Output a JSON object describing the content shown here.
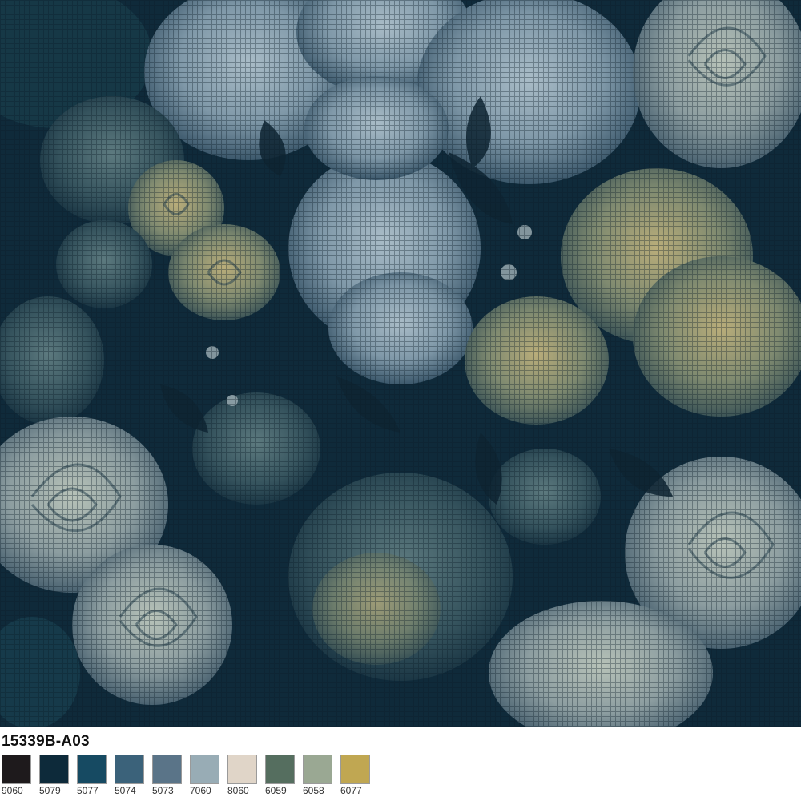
{
  "pattern": {
    "code": "15339B-A03",
    "palette": [
      {
        "number": "9060",
        "color": "#1e1a1c"
      },
      {
        "number": "5079",
        "color": "#0d2a3a"
      },
      {
        "number": "5077",
        "color": "#164a62"
      },
      {
        "number": "5074",
        "color": "#3b627a"
      },
      {
        "number": "5073",
        "color": "#5a7488"
      },
      {
        "number": "7060",
        "color": "#98acb5"
      },
      {
        "number": "8060",
        "color": "#e0d5c8"
      },
      {
        "number": "6059",
        "color": "#556e5f"
      },
      {
        "number": "6058",
        "color": "#9aa893"
      },
      {
        "number": "6077",
        "color": "#c0a752"
      }
    ]
  },
  "artwork": {
    "subject_icon": "floral-rose-pattern"
  }
}
